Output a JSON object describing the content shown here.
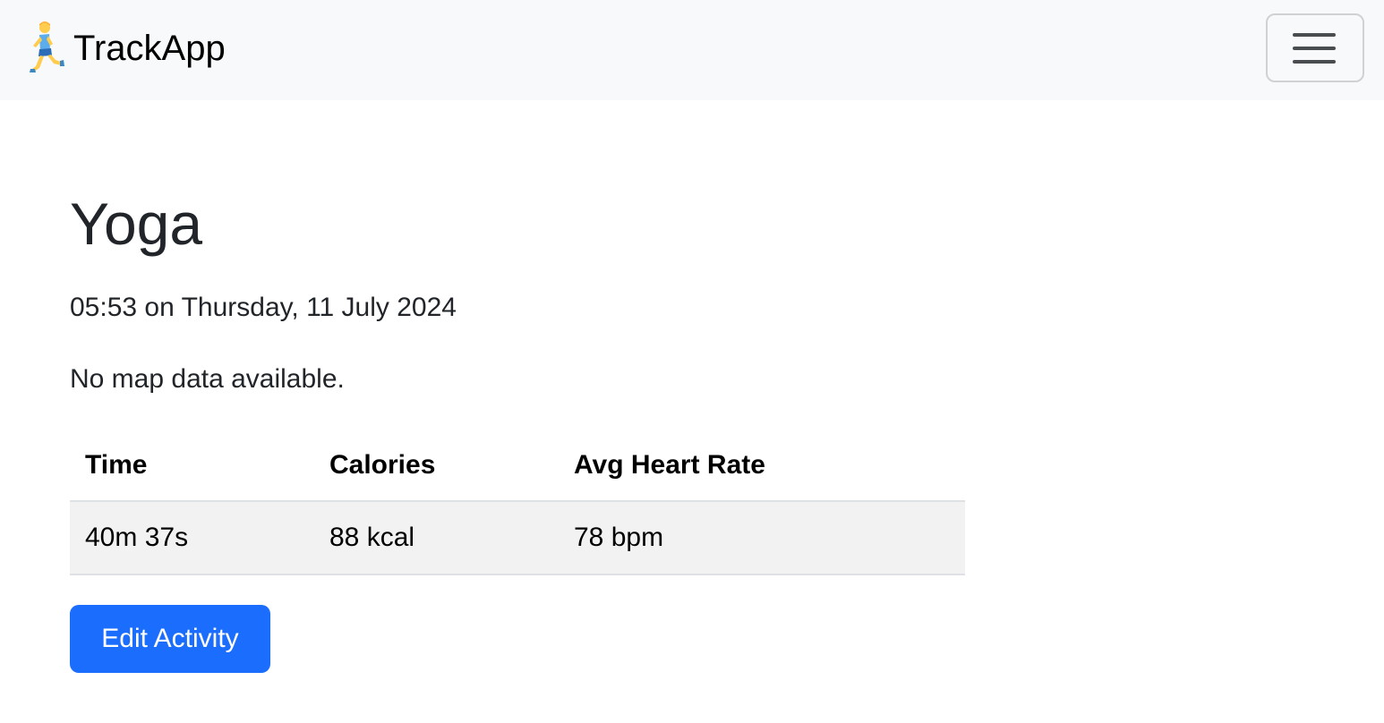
{
  "navbar": {
    "brand_icon": "runner-emoji-icon",
    "brand_name": "TrackApp",
    "toggle_icon": "hamburger-menu-icon"
  },
  "activity": {
    "title": "Yoga",
    "datetime": "05:53 on Thursday, 11 July 2024",
    "map_message": "No map data available."
  },
  "stats_table": {
    "headers": [
      "Time",
      "Calories",
      "Avg Heart Rate"
    ],
    "rows": [
      [
        "40m 37s",
        "88 kcal",
        "78 bpm"
      ]
    ]
  },
  "actions": {
    "edit_label": "Edit Activity"
  },
  "colors": {
    "navbar_bg": "#f8f9fa",
    "primary_button": "#1b6efd",
    "row_bg": "#f2f2f2"
  }
}
